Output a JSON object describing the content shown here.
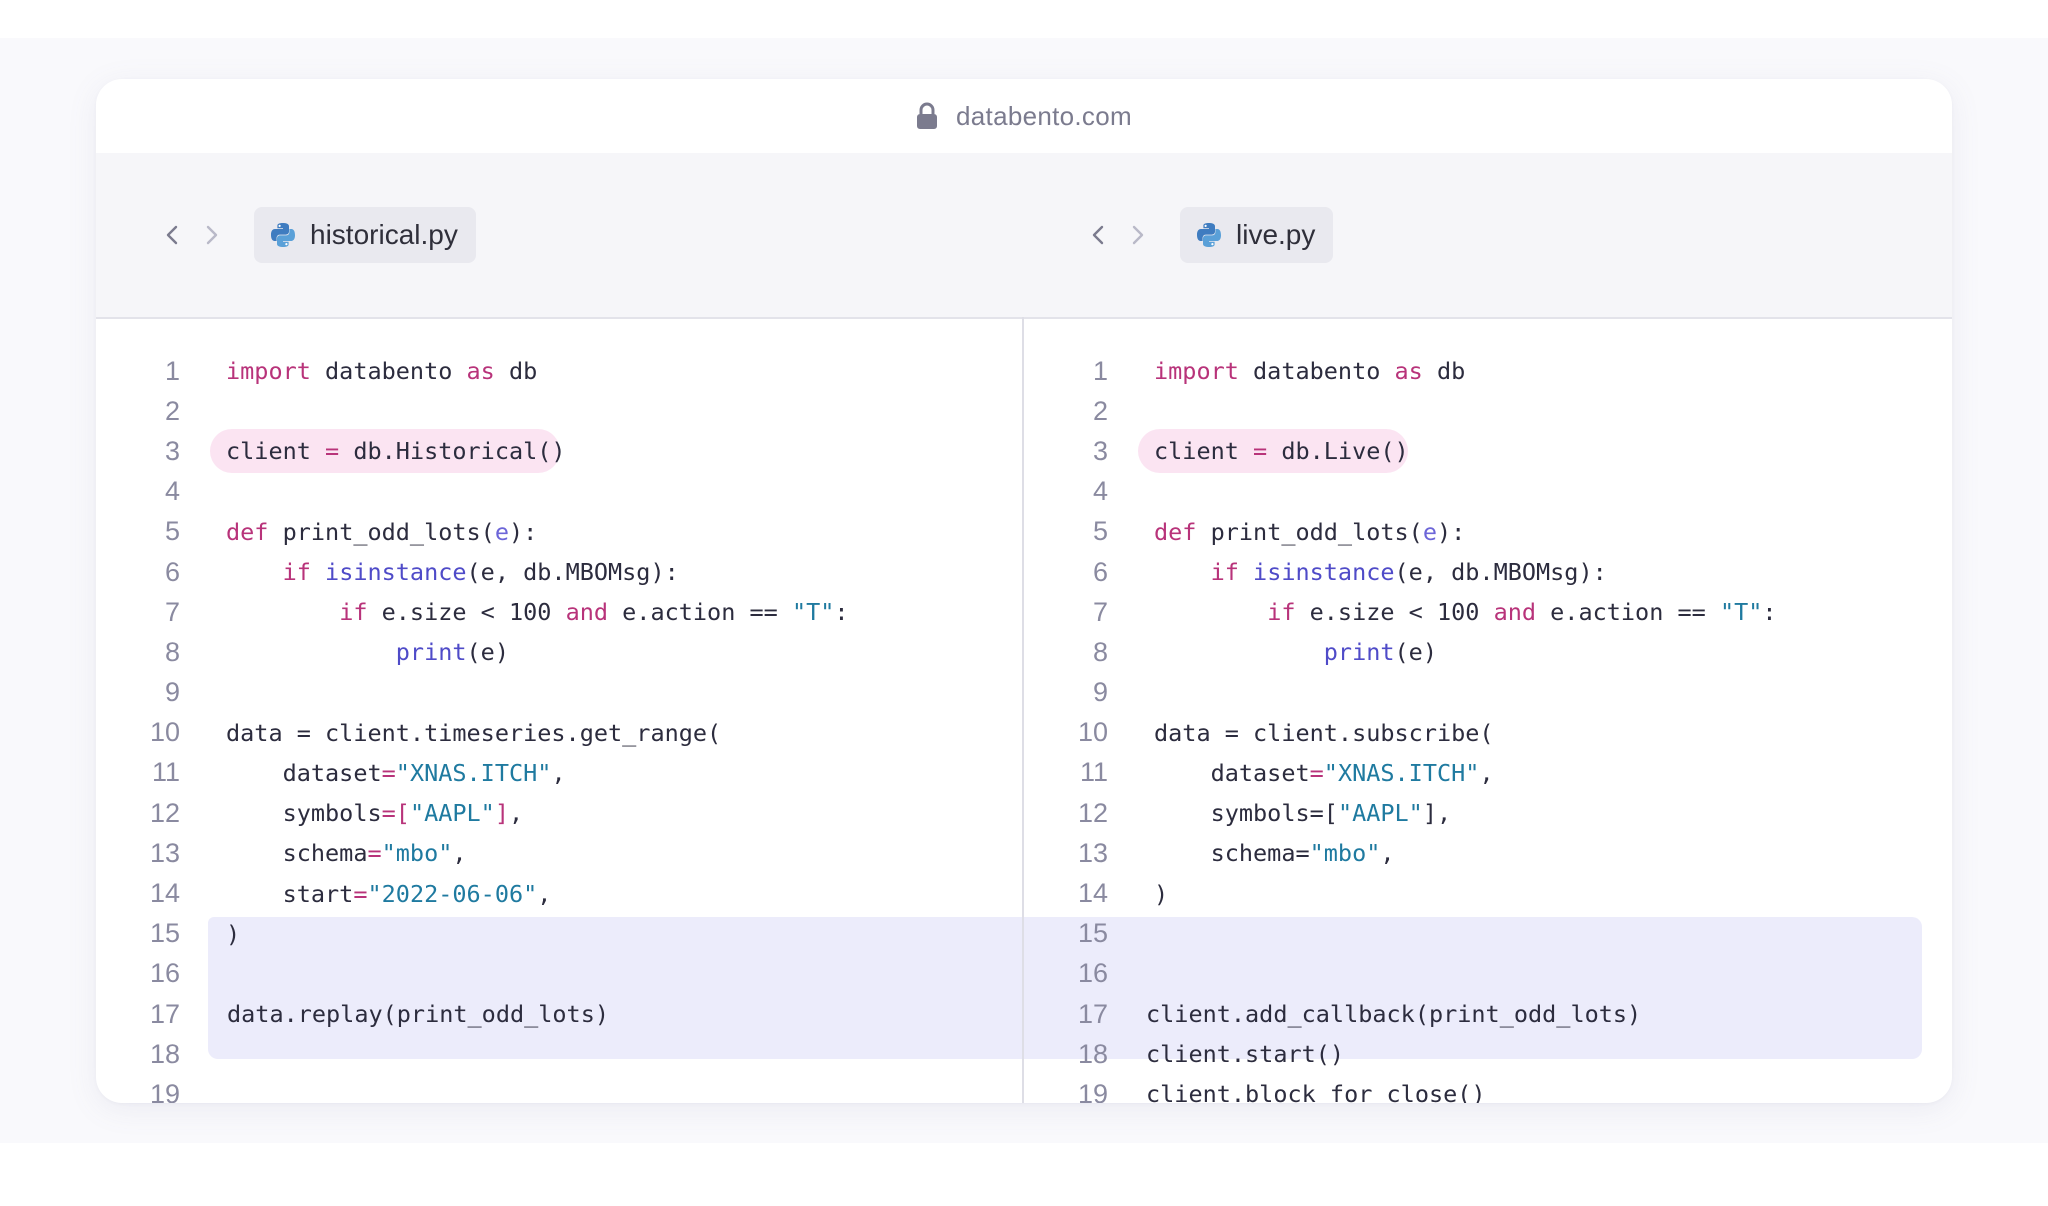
{
  "address_bar": {
    "url": "databento.com",
    "icon": "lock-icon"
  },
  "left_pane": {
    "tab": {
      "filename": "historical.py",
      "icon": "python-icon"
    },
    "lines": [
      {
        "n": "1",
        "tokens": [
          [
            "kw",
            "import"
          ],
          [
            "t",
            " databento "
          ],
          [
            "kw",
            "as"
          ],
          [
            "t",
            " db"
          ]
        ]
      },
      {
        "n": "2",
        "tokens": []
      },
      {
        "n": "3",
        "tokens": [
          [
            "t",
            "client "
          ],
          [
            "kw",
            "="
          ],
          [
            "t",
            " db.Historical()"
          ]
        ],
        "pill": true
      },
      {
        "n": "4",
        "tokens": []
      },
      {
        "n": "5",
        "tokens": [
          [
            "kw",
            "def"
          ],
          [
            "t",
            " print_odd_lots("
          ],
          [
            "param",
            "e"
          ],
          [
            "t",
            "):"
          ]
        ]
      },
      {
        "n": "6",
        "tokens": [
          [
            "t",
            "    "
          ],
          [
            "kw",
            "if"
          ],
          [
            "t",
            " "
          ],
          [
            "bi",
            "isinstance"
          ],
          [
            "t",
            "(e, db.MBOMsg):"
          ]
        ]
      },
      {
        "n": "7",
        "tokens": [
          [
            "t",
            "        "
          ],
          [
            "kw",
            "if"
          ],
          [
            "t",
            " e.size < 100 "
          ],
          [
            "kw",
            "and"
          ],
          [
            "t",
            " e.action == "
          ],
          [
            "str",
            "\"T\""
          ],
          [
            "t",
            ":"
          ]
        ]
      },
      {
        "n": "8",
        "tokens": [
          [
            "t",
            "            "
          ],
          [
            "bi",
            "print"
          ],
          [
            "t",
            "(e)"
          ]
        ]
      },
      {
        "n": "9",
        "tokens": []
      },
      {
        "n": "10",
        "tokens": [
          [
            "t",
            "data = client.timeseries.get_range("
          ]
        ]
      },
      {
        "n": "11",
        "tokens": [
          [
            "t",
            "    dataset"
          ],
          [
            "kw",
            "="
          ],
          [
            "str",
            "\"XNAS.ITCH\""
          ],
          [
            "t",
            ","
          ]
        ]
      },
      {
        "n": "12",
        "tokens": [
          [
            "t",
            "    symbols"
          ],
          [
            "kw",
            "=["
          ],
          [
            "str",
            "\"AAPL\""
          ],
          [
            "kw",
            "]"
          ],
          [
            "t",
            ","
          ]
        ]
      },
      {
        "n": "13",
        "tokens": [
          [
            "t",
            "    schema"
          ],
          [
            "kw",
            "="
          ],
          [
            "str",
            "\"mbo\""
          ],
          [
            "t",
            ","
          ]
        ]
      },
      {
        "n": "14",
        "tokens": [
          [
            "t",
            "    start"
          ],
          [
            "kw",
            "="
          ],
          [
            "str",
            "\"2022-06-06\""
          ],
          [
            "t",
            ","
          ]
        ]
      },
      {
        "n": "15",
        "tokens": [
          [
            "t",
            ")"
          ]
        ]
      },
      {
        "n": "16",
        "tokens": []
      },
      {
        "n": "17",
        "tokens": [
          [
            "t",
            "data.replay(print_odd_lots)"
          ]
        ]
      },
      {
        "n": "18",
        "tokens": []
      },
      {
        "n": "19",
        "tokens": []
      }
    ]
  },
  "right_pane": {
    "tab": {
      "filename": "live.py",
      "icon": "python-icon"
    },
    "lines": [
      {
        "n": "1",
        "tokens": [
          [
            "kw",
            "import"
          ],
          [
            "t",
            " databento "
          ],
          [
            "kw",
            "as"
          ],
          [
            "t",
            " db"
          ]
        ]
      },
      {
        "n": "2",
        "tokens": []
      },
      {
        "n": "3",
        "tokens": [
          [
            "t",
            "client "
          ],
          [
            "kw",
            "="
          ],
          [
            "t",
            " db.Live()"
          ]
        ],
        "pill": true
      },
      {
        "n": "4",
        "tokens": []
      },
      {
        "n": "5",
        "tokens": [
          [
            "kw",
            "def"
          ],
          [
            "t",
            " print_odd_lots("
          ],
          [
            "param",
            "e"
          ],
          [
            "t",
            "):"
          ]
        ]
      },
      {
        "n": "6",
        "tokens": [
          [
            "t",
            "    "
          ],
          [
            "kw",
            "if"
          ],
          [
            "t",
            " "
          ],
          [
            "bi",
            "isinstance"
          ],
          [
            "t",
            "(e, db.MBOMsg):"
          ]
        ]
      },
      {
        "n": "7",
        "tokens": [
          [
            "t",
            "        "
          ],
          [
            "kw",
            "if"
          ],
          [
            "t",
            " e.size < 100 "
          ],
          [
            "kw",
            "and"
          ],
          [
            "t",
            " e.action == "
          ],
          [
            "str",
            "\"T\""
          ],
          [
            "t",
            ":"
          ]
        ]
      },
      {
        "n": "8",
        "tokens": [
          [
            "t",
            "            "
          ],
          [
            "bi",
            "print"
          ],
          [
            "t",
            "(e)"
          ]
        ]
      },
      {
        "n": "9",
        "tokens": []
      },
      {
        "n": "10",
        "tokens": [
          [
            "t",
            "data = client.subscribe("
          ]
        ]
      },
      {
        "n": "11",
        "tokens": [
          [
            "t",
            "    dataset"
          ],
          [
            "kw",
            "="
          ],
          [
            "str",
            "\"XNAS.ITCH\""
          ],
          [
            "t",
            ","
          ]
        ]
      },
      {
        "n": "12",
        "tokens": [
          [
            "t",
            "    symbols=["
          ],
          [
            "str",
            "\"AAPL\""
          ],
          [
            "t",
            "],"
          ]
        ]
      },
      {
        "n": "13",
        "tokens": [
          [
            "t",
            "    schema="
          ],
          [
            "str",
            "\"mbo\""
          ],
          [
            "t",
            ","
          ]
        ]
      },
      {
        "n": "14",
        "tokens": [
          [
            "t",
            ")"
          ]
        ]
      },
      {
        "n": "15",
        "tokens": []
      },
      {
        "n": "16",
        "tokens": []
      },
      {
        "n": "17",
        "tokens": [
          [
            "t",
            "client.add_callback(print_odd_lots)"
          ]
        ]
      },
      {
        "n": "18",
        "tokens": [
          [
            "t",
            "client.start()"
          ]
        ]
      },
      {
        "n": "19",
        "tokens": [
          [
            "t",
            "client.block_for_close()"
          ]
        ]
      }
    ]
  },
  "colors": {
    "keyword": "#b8337a",
    "builtin": "#4f4bc8",
    "string": "#1f7aa0",
    "highlight_block": "#ececfb",
    "highlight_pill": "#fbe4f2"
  }
}
